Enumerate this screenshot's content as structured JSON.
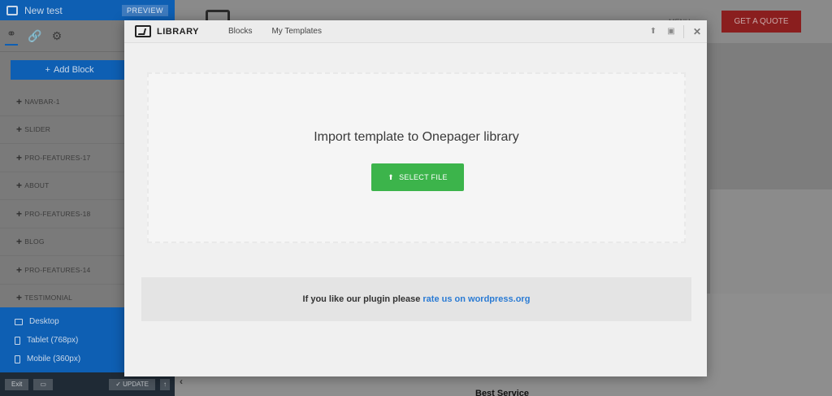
{
  "sidebar": {
    "page_title": "New test",
    "preview_label": "PREVIEW",
    "add_block_label": "Add Block",
    "blocks": [
      {
        "label": "NAVBAR-1"
      },
      {
        "label": "SLIDER"
      },
      {
        "label": "PRO-FEATURES-17"
      },
      {
        "label": "ABOUT"
      },
      {
        "label": "PRO-FEATURES-18"
      },
      {
        "label": "BLOG"
      },
      {
        "label": "PRO-FEATURES-14"
      },
      {
        "label": "TESTIMONIAL"
      }
    ],
    "devices": [
      {
        "label": "Desktop",
        "icon": "desktop-icon"
      },
      {
        "label": "Tablet (768px)",
        "icon": "tablet-icon"
      },
      {
        "label": "Mobile (360px)",
        "icon": "mobile-icon"
      }
    ],
    "exit_label": "Exit",
    "update_label": "UPDATE"
  },
  "background": {
    "menu_text": "MENU",
    "quote_button": "GET A QUOTE",
    "service_text": "Best Service"
  },
  "modal": {
    "title": "LIBRARY",
    "tabs": [
      "Blocks",
      "My Templates"
    ],
    "import_text": "Import template to Onepager library",
    "select_file_label": "SELECT FILE",
    "rate_text": "If you like our plugin please",
    "rate_link": "rate us on wordpress.org"
  },
  "colors": {
    "accent_blue": "#0e5fb3",
    "select_green": "#3cb44b",
    "quote_red": "#c62828",
    "link_blue": "#2a7bd4"
  }
}
